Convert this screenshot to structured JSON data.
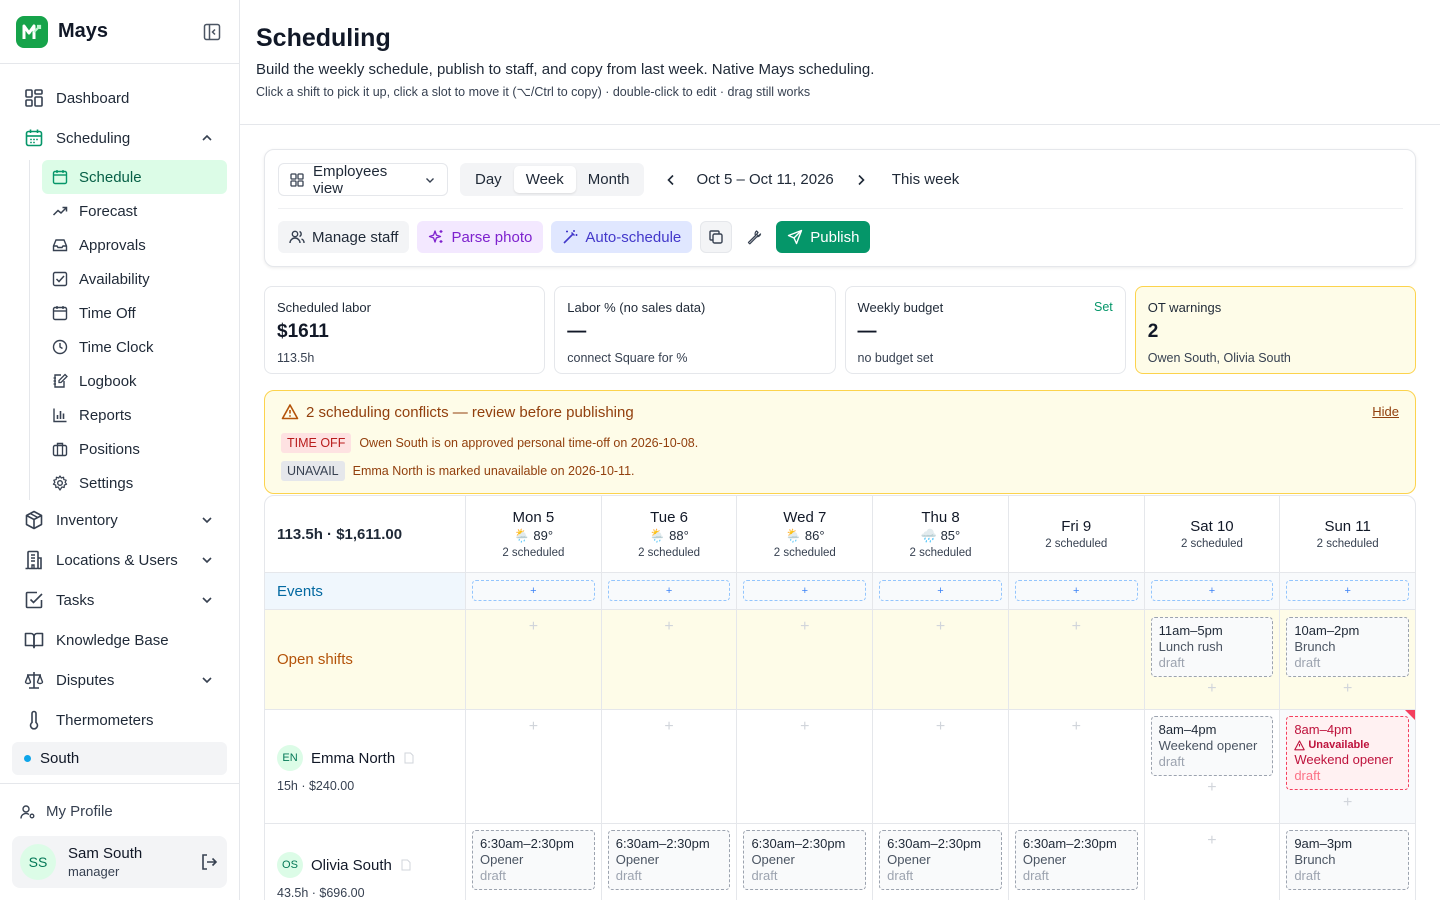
{
  "brand": {
    "name": "Mays"
  },
  "nav": {
    "dashboard": "Dashboard",
    "scheduling": "Scheduling",
    "sub": [
      "Schedule",
      "Forecast",
      "Approvals",
      "Availability",
      "Time Off",
      "Time Clock",
      "Logbook",
      "Reports",
      "Positions",
      "Settings"
    ],
    "inventory": "Inventory",
    "locations": "Locations & Users",
    "tasks": "Tasks",
    "knowledge": "Knowledge Base",
    "disputes": "Disputes",
    "thermometers": "Thermometers"
  },
  "location": {
    "name": "South",
    "color": "#0ea5e9"
  },
  "profile": {
    "link": "My Profile",
    "initials": "SS",
    "name": "Sam South",
    "role": "manager"
  },
  "page": {
    "title": "Scheduling",
    "subtitle": "Build the weekly schedule, publish to staff, and copy from last week. Native Mays scheduling.",
    "hint": "Click a shift to pick it up, click a slot to move it (⌥/Ctrl to copy) · double-click to edit · drag still works"
  },
  "toolbar": {
    "view": "Employees view",
    "modes": [
      "Day",
      "Week",
      "Month"
    ],
    "active_mode": "Week",
    "range": "Oct 5 – Oct 11, 2026",
    "this_week": "This week",
    "manage_staff": "Manage staff",
    "parse_photo": "Parse photo",
    "auto_schedule": "Auto-schedule",
    "publish": "Publish"
  },
  "stats": [
    {
      "label": "Scheduled labor",
      "value": "$1611",
      "sub": "113.5h"
    },
    {
      "label": "Labor % (no sales data)",
      "value": "—",
      "sub": "connect Square for %"
    },
    {
      "label": "Weekly budget",
      "value": "—",
      "sub": "no budget set",
      "link": "Set"
    },
    {
      "label": "OT warnings",
      "value": "2",
      "sub": "Owen South, Olivia South"
    }
  ],
  "conflicts": {
    "title": "2 scheduling conflicts — review before publishing",
    "hide": "Hide",
    "items": [
      {
        "tag": "TIME OFF",
        "text": "Owen South is on approved personal time-off on 2026-10-08."
      },
      {
        "tag": "UNAVAIL",
        "text": "Emma North is marked unavailable on 2026-10-11."
      }
    ]
  },
  "grid": {
    "summary": "113.5h · $1,611.00",
    "days": [
      {
        "name": "Mon 5",
        "weather": "🌦️ 89°",
        "scheduled": "2 scheduled"
      },
      {
        "name": "Tue 6",
        "weather": "🌦️ 88°",
        "scheduled": "2 scheduled"
      },
      {
        "name": "Wed 7",
        "weather": "🌦️ 86°",
        "scheduled": "2 scheduled"
      },
      {
        "name": "Thu 8",
        "weather": "🌧️ 85°",
        "scheduled": "2 scheduled"
      },
      {
        "name": "Fri 9",
        "weather": "",
        "scheduled": "2 scheduled"
      },
      {
        "name": "Sat 10",
        "weather": "",
        "scheduled": "2 scheduled"
      },
      {
        "name": "Sun 11",
        "weather": "",
        "scheduled": "2 scheduled"
      }
    ],
    "events_label": "Events",
    "add": "+",
    "open_label": "Open shifts",
    "open_shifts": {
      "sat": {
        "time": "11am–5pm",
        "role": "Lunch rush",
        "status": "draft"
      },
      "sun": {
        "time": "10am–2pm",
        "role": "Brunch",
        "status": "draft"
      }
    },
    "employees": [
      {
        "initials": "EN",
        "name": "Emma North",
        "sub": "15h · $240.00",
        "sat": {
          "time": "8am–4pm",
          "role": "Weekend opener",
          "status": "draft"
        },
        "sun": {
          "time": "8am–4pm",
          "warning": "Unavailable",
          "role": "Weekend opener",
          "status": "draft"
        }
      },
      {
        "initials": "OS",
        "name": "Olivia South",
        "sub": "43.5h · $696.00",
        "weekday": {
          "time": "6:30am–2:30pm",
          "role": "Opener",
          "status": "draft"
        },
        "sun": {
          "time": "9am–3pm",
          "role": "Brunch",
          "status": "draft"
        }
      }
    ]
  }
}
